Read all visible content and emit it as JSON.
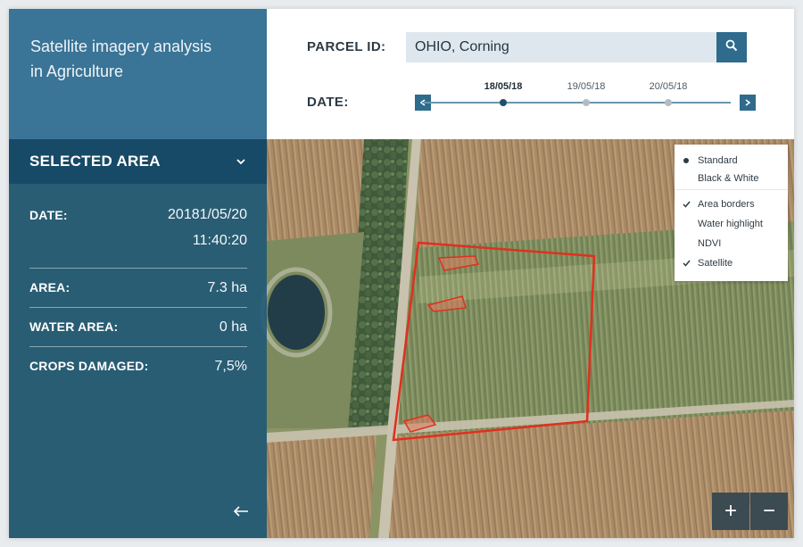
{
  "app": {
    "title": "Satellite imagery analysis\nin Agriculture"
  },
  "selected_area": {
    "title": "SELECTED AREA",
    "rows": [
      {
        "label": "DATE:",
        "value_line1": "20181/05/20",
        "value_line2": "11:40:20"
      },
      {
        "label": "AREA:",
        "value": "7.3 ha"
      },
      {
        "label": "WATER AREA:",
        "value": "0 ha"
      },
      {
        "label": "CROPS DAMAGED:",
        "value": "7,5%"
      }
    ]
  },
  "parcel": {
    "label": "PARCEL ID:",
    "value": "OHIO, Corning"
  },
  "date_picker": {
    "label": "DATE:",
    "dates": [
      "18/05/18",
      "19/05/18",
      "20/05/18"
    ],
    "active_index": 0
  },
  "layers": {
    "styles": [
      {
        "label": "Standard",
        "selected": true
      },
      {
        "label": "Black & White",
        "selected": false
      }
    ],
    "overlays": [
      {
        "label": "Area borders",
        "checked": true
      },
      {
        "label": "Water highlight",
        "checked": false
      },
      {
        "label": "NDVI",
        "checked": false
      },
      {
        "label": "Satellite",
        "checked": true
      }
    ]
  },
  "zoom": {
    "in": "+",
    "out": "−"
  },
  "icons": {
    "search": "search-icon",
    "chevron": "chevron-down-icon",
    "prev": "chevron-left-icon",
    "next": "chevron-right-icon",
    "back": "arrow-left-icon"
  },
  "colors": {
    "accent": "#2e6b8c",
    "sidebar": "#185476",
    "parcel_border": "#e0301e",
    "damage": "#e07a5f"
  }
}
